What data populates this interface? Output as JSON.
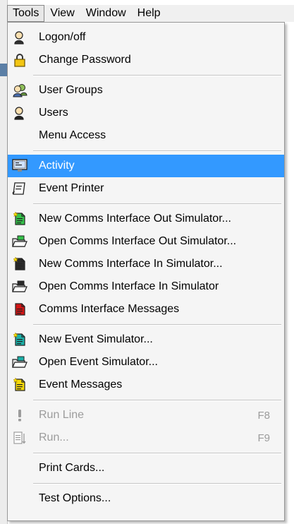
{
  "menubar": {
    "items": [
      {
        "label": "Tools",
        "open": true
      },
      {
        "label": "View"
      },
      {
        "label": "Window"
      },
      {
        "label": "Help"
      }
    ]
  },
  "tools_menu": {
    "items": [
      {
        "label": "Logon/off",
        "icon": "user-key-icon"
      },
      {
        "label": "Change Password",
        "icon": "padlock-icon"
      },
      {
        "separator": true
      },
      {
        "label": "User Groups",
        "icon": "user-group-icon"
      },
      {
        "label": "Users",
        "icon": "user-icon"
      },
      {
        "label": "Menu Access",
        "icon": ""
      },
      {
        "separator": true
      },
      {
        "label": "Activity",
        "icon": "monitor-icon",
        "highlighted": true
      },
      {
        "label": "Event Printer",
        "icon": "printer-scroll-icon"
      },
      {
        "separator": true
      },
      {
        "label": "New Comms Interface Out Simulator...",
        "icon": "new-doc-green-icon"
      },
      {
        "label": "Open Comms Interface Out Simulator...",
        "icon": "open-folder-green-icon"
      },
      {
        "label": "New Comms Interface In Simulator...",
        "icon": "new-doc-black-icon"
      },
      {
        "label": "Open Comms Interface In Simulator",
        "icon": "open-folder-black-icon"
      },
      {
        "label": "Comms Interface Messages",
        "icon": "doc-red-icon"
      },
      {
        "separator": true
      },
      {
        "label": "New Event Simulator...",
        "icon": "new-doc-teal-icon"
      },
      {
        "label": "Open Event Simulator...",
        "icon": "open-folder-teal-icon"
      },
      {
        "label": "Event Messages",
        "icon": "doc-yellow-icon"
      },
      {
        "separator": true
      },
      {
        "label": "Run Line",
        "icon": "exclamation-icon",
        "shortcut": "F8",
        "disabled": true
      },
      {
        "label": "Run...",
        "icon": "run-list-icon",
        "shortcut": "F9",
        "disabled": true
      },
      {
        "separator": true
      },
      {
        "label": "Print Cards...",
        "icon": ""
      },
      {
        "separator": true
      },
      {
        "label": "Test Options...",
        "icon": ""
      }
    ]
  },
  "colors": {
    "highlight": "#3399ff",
    "disabled_text": "#9c9c9c",
    "menu_background": "#f5f5f5"
  }
}
